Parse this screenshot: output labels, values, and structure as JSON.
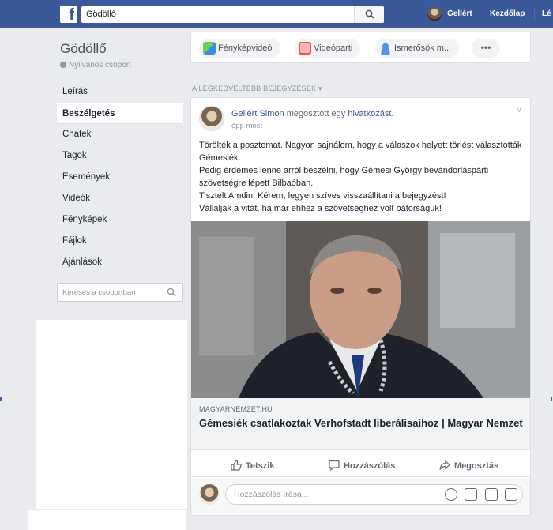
{
  "topbar": {
    "logo": "f",
    "search_value": "Gödöllő",
    "user_name": "Gellért",
    "home_label": "Kezdőlap",
    "more_label": "Lé"
  },
  "sidebar": {
    "group_name": "Gödöllő",
    "group_privacy": "Nyilvános csoport",
    "items": [
      {
        "label": "Leírás"
      },
      {
        "label": "Beszélgetés"
      },
      {
        "label": "Chatek"
      },
      {
        "label": "Tagok"
      },
      {
        "label": "Események"
      },
      {
        "label": "Videók"
      },
      {
        "label": "Fényképek"
      },
      {
        "label": "Fájlok"
      },
      {
        "label": "Ajánlások"
      }
    ],
    "search_placeholder": "Keresés a csoportban"
  },
  "composer": {
    "photo_video": "Fényképvideó",
    "watch_party": "Videóparti",
    "tag_friends": "Ismerősök m...",
    "more": "•••"
  },
  "feed": {
    "section_label": "A LEGKEDVELTEBB BEJEGYZÉSEK ▾"
  },
  "post": {
    "author": "Gellért Simon",
    "shared_text": "megosztott egy",
    "link_word": "hivatkozást.",
    "time": "épp most",
    "lines": [
      "Törölték a posztomat. Nagyon sajnálom, hogy a válaszok helyett törlést választották Gémesiék.",
      "Pedig érdemes lenne arról beszélni, hogy Gémesi György bevándorláspárti szövetségre lépett Bilbaóban.",
      "Tisztelt Amdin! Kérem, legyen szíves visszaállítani a bejegyzést!",
      "Vállalják a vitát, ha már ehhez a szövetséghez volt bátorságuk!"
    ],
    "link_domain": "MAGYARNEMZET.HU",
    "link_title": "Gémesiék csatlakoztak Verhofstadt liberálisaihoz | Magyar Nemzet",
    "actions": {
      "like": "Tetszik",
      "comment": "Hozzászólás",
      "share": "Megosztás"
    },
    "comment_placeholder": "Hozzászólás írása..."
  },
  "colors": {
    "brand": "#3b5998",
    "link": "#365899",
    "background": "#e9ebee"
  }
}
